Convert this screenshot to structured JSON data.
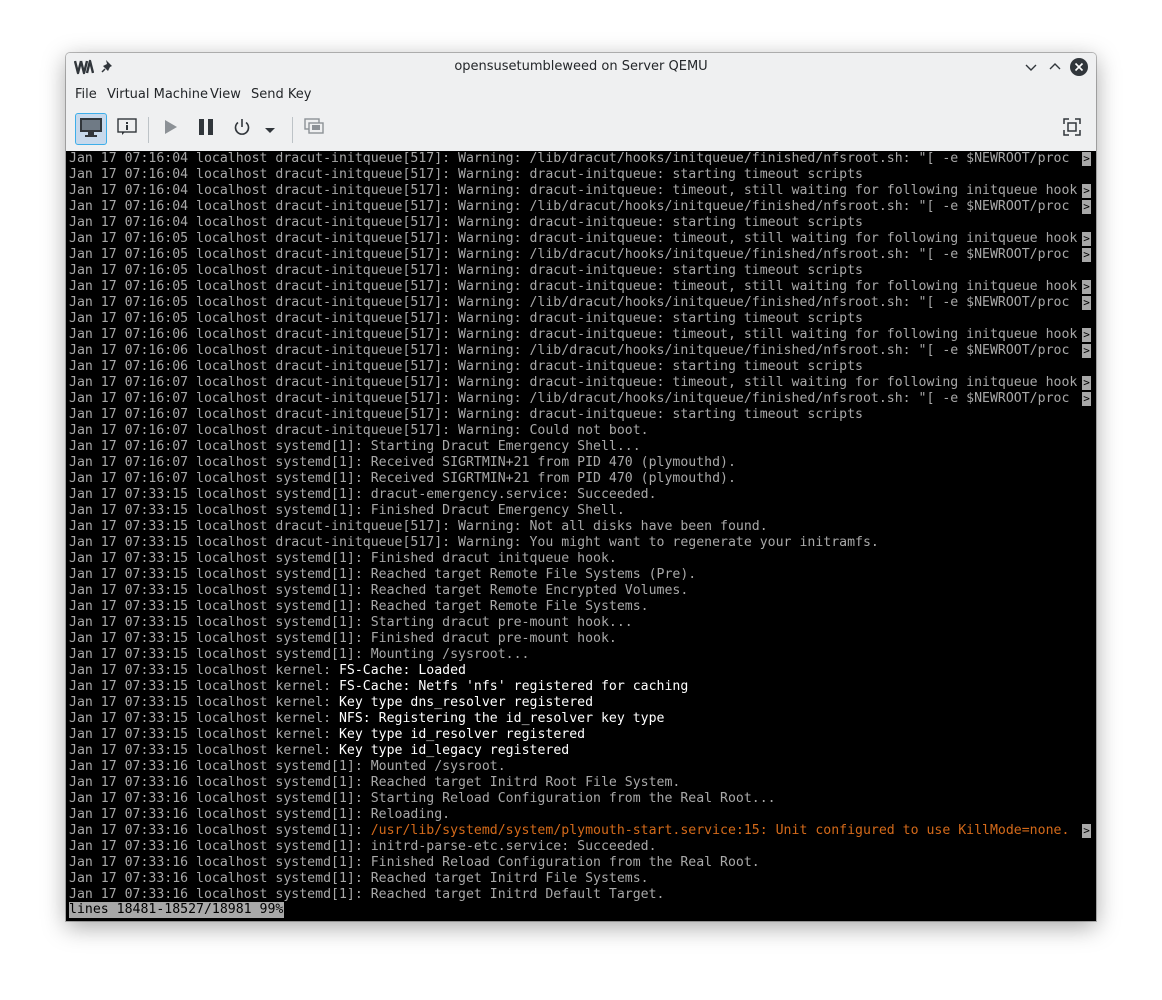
{
  "window": {
    "title": "opensusetumbleweed on Server QEMU"
  },
  "titlebar_icons": {
    "app": "virt-manager-icon",
    "pin": "pin-icon",
    "minimize": "chevron-down-icon",
    "maximize": "chevron-up-icon",
    "close": "close-icon"
  },
  "menu": {
    "file": "File",
    "vm": "Virtual Machine",
    "view": "View",
    "send_key": "Send Key"
  },
  "toolbar": {
    "console": "monitor-icon",
    "details": "info-icon",
    "run": "play-icon",
    "pause": "pause-icon",
    "shutdown": "power-icon",
    "shutdown_menu": "dropdown-arrow-icon",
    "snapshots": "snapshot-icon",
    "fullscreen": "fullscreen-icon"
  },
  "colors": {
    "console_text": "#a8a8a8",
    "highlight_text": "#ffffff",
    "warning_text": "#d46a1a",
    "console_bg": "#000000"
  },
  "console": {
    "lines": [
      {
        "text": "Jan 17 07:16:04 localhost dracut-initqueue[517]: Warning: /lib/dracut/hooks/initqueue/finished/nfsroot.sh: \"[ -e $NEWROOT/proc",
        "trunc": true
      },
      {
        "text": "Jan 17 07:16:04 localhost dracut-initqueue[517]: Warning: dracut-initqueue: starting timeout scripts"
      },
      {
        "text": "Jan 17 07:16:04 localhost dracut-initqueue[517]: Warning: dracut-initqueue: timeout, still waiting for following initqueue hook",
        "trunc": true
      },
      {
        "text": "Jan 17 07:16:04 localhost dracut-initqueue[517]: Warning: /lib/dracut/hooks/initqueue/finished/nfsroot.sh: \"[ -e $NEWROOT/proc",
        "trunc": true
      },
      {
        "text": "Jan 17 07:16:04 localhost dracut-initqueue[517]: Warning: dracut-initqueue: starting timeout scripts"
      },
      {
        "text": "Jan 17 07:16:05 localhost dracut-initqueue[517]: Warning: dracut-initqueue: timeout, still waiting for following initqueue hook",
        "trunc": true
      },
      {
        "text": "Jan 17 07:16:05 localhost dracut-initqueue[517]: Warning: /lib/dracut/hooks/initqueue/finished/nfsroot.sh: \"[ -e $NEWROOT/proc",
        "trunc": true
      },
      {
        "text": "Jan 17 07:16:05 localhost dracut-initqueue[517]: Warning: dracut-initqueue: starting timeout scripts"
      },
      {
        "text": "Jan 17 07:16:05 localhost dracut-initqueue[517]: Warning: dracut-initqueue: timeout, still waiting for following initqueue hook",
        "trunc": true
      },
      {
        "text": "Jan 17 07:16:05 localhost dracut-initqueue[517]: Warning: /lib/dracut/hooks/initqueue/finished/nfsroot.sh: \"[ -e $NEWROOT/proc",
        "trunc": true
      },
      {
        "text": "Jan 17 07:16:05 localhost dracut-initqueue[517]: Warning: dracut-initqueue: starting timeout scripts"
      },
      {
        "text": "Jan 17 07:16:06 localhost dracut-initqueue[517]: Warning: dracut-initqueue: timeout, still waiting for following initqueue hook",
        "trunc": true
      },
      {
        "text": "Jan 17 07:16:06 localhost dracut-initqueue[517]: Warning: /lib/dracut/hooks/initqueue/finished/nfsroot.sh: \"[ -e $NEWROOT/proc",
        "trunc": true
      },
      {
        "text": "Jan 17 07:16:06 localhost dracut-initqueue[517]: Warning: dracut-initqueue: starting timeout scripts"
      },
      {
        "text": "Jan 17 07:16:07 localhost dracut-initqueue[517]: Warning: dracut-initqueue: timeout, still waiting for following initqueue hook",
        "trunc": true
      },
      {
        "text": "Jan 17 07:16:07 localhost dracut-initqueue[517]: Warning: /lib/dracut/hooks/initqueue/finished/nfsroot.sh: \"[ -e $NEWROOT/proc",
        "trunc": true
      },
      {
        "text": "Jan 17 07:16:07 localhost dracut-initqueue[517]: Warning: dracut-initqueue: starting timeout scripts"
      },
      {
        "text": "Jan 17 07:16:07 localhost dracut-initqueue[517]: Warning: Could not boot."
      },
      {
        "text": "Jan 17 07:16:07 localhost systemd[1]: Starting Dracut Emergency Shell..."
      },
      {
        "text": "Jan 17 07:16:07 localhost systemd[1]: Received SIGRTMIN+21 from PID 470 (plymouthd)."
      },
      {
        "text": "Jan 17 07:16:07 localhost systemd[1]: Received SIGRTMIN+21 from PID 470 (plymouthd)."
      },
      {
        "text": "Jan 17 07:33:15 localhost systemd[1]: dracut-emergency.service: Succeeded."
      },
      {
        "text": "Jan 17 07:33:15 localhost systemd[1]: Finished Dracut Emergency Shell."
      },
      {
        "text": "Jan 17 07:33:15 localhost dracut-initqueue[517]: Warning: Not all disks have been found."
      },
      {
        "text": "Jan 17 07:33:15 localhost dracut-initqueue[517]: Warning: You might want to regenerate your initramfs."
      },
      {
        "text": "Jan 17 07:33:15 localhost systemd[1]: Finished dracut initqueue hook."
      },
      {
        "text": "Jan 17 07:33:15 localhost systemd[1]: Reached target Remote File Systems (Pre)."
      },
      {
        "text": "Jan 17 07:33:15 localhost systemd[1]: Reached target Remote Encrypted Volumes."
      },
      {
        "text": "Jan 17 07:33:15 localhost systemd[1]: Reached target Remote File Systems."
      },
      {
        "text": "Jan 17 07:33:15 localhost systemd[1]: Starting dracut pre-mount hook..."
      },
      {
        "text": "Jan 17 07:33:15 localhost systemd[1]: Finished dracut pre-mount hook."
      },
      {
        "text": "Jan 17 07:33:15 localhost systemd[1]: Mounting /sysroot..."
      },
      {
        "text": "Jan 17 07:33:15 localhost kernel: ",
        "hl": "FS-Cache: Loaded"
      },
      {
        "text": "Jan 17 07:33:15 localhost kernel: ",
        "hl": "FS-Cache: Netfs 'nfs' registered for caching"
      },
      {
        "text": "Jan 17 07:33:15 localhost kernel: ",
        "hl": "Key type dns_resolver registered"
      },
      {
        "text": "Jan 17 07:33:15 localhost kernel: ",
        "hl": "NFS: Registering the id_resolver key type"
      },
      {
        "text": "Jan 17 07:33:15 localhost kernel: ",
        "hl": "Key type id_resolver registered"
      },
      {
        "text": "Jan 17 07:33:15 localhost kernel: ",
        "hl": "Key type id_legacy registered"
      },
      {
        "text": "Jan 17 07:33:16 localhost systemd[1]: Mounted /sysroot."
      },
      {
        "text": "Jan 17 07:33:16 localhost systemd[1]: Reached target Initrd Root File System."
      },
      {
        "text": "Jan 17 07:33:16 localhost systemd[1]: Starting Reload Configuration from the Real Root..."
      },
      {
        "text": "Jan 17 07:33:16 localhost systemd[1]: Reloading."
      },
      {
        "text": "Jan 17 07:33:16 localhost systemd[1]: ",
        "warn": "/usr/lib/systemd/system/plymouth-start.service:15: Unit configured to use KillMode=none.",
        "trunc": true
      },
      {
        "text": "Jan 17 07:33:16 localhost systemd[1]: initrd-parse-etc.service: Succeeded."
      },
      {
        "text": "Jan 17 07:33:16 localhost systemd[1]: Finished Reload Configuration from the Real Root."
      },
      {
        "text": "Jan 17 07:33:16 localhost systemd[1]: Reached target Initrd File Systems."
      },
      {
        "text": "Jan 17 07:33:16 localhost systemd[1]: Reached target Initrd Default Target."
      }
    ],
    "truncation_marker": ">",
    "status": "lines 18481-18527/18981 99%"
  }
}
